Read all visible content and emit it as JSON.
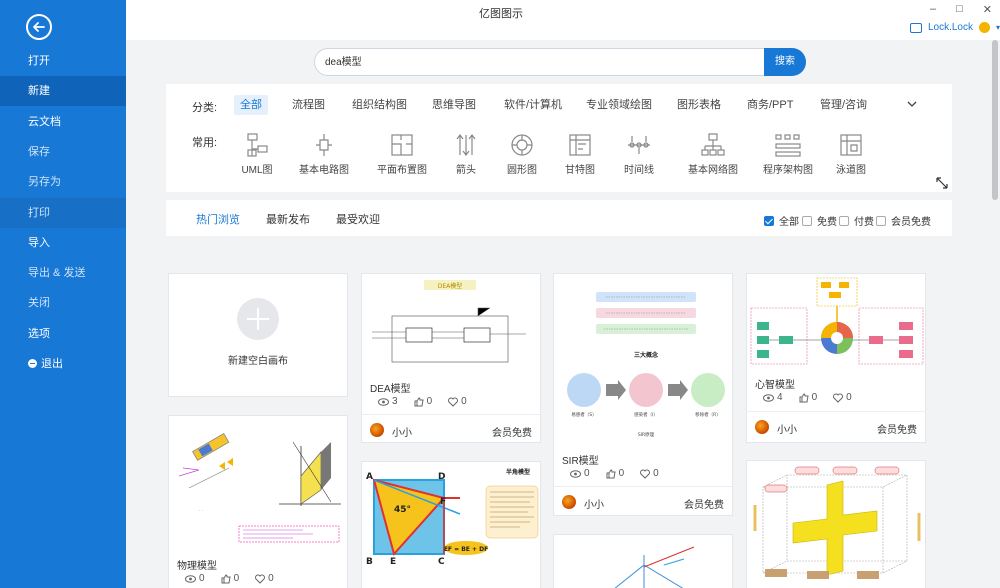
{
  "app": {
    "title": "亿图图示"
  },
  "window": {
    "minimize": "–",
    "maximize": "□",
    "close": "✕"
  },
  "user": {
    "name": "Lock.Lock",
    "caret": "▾"
  },
  "sidebar": {
    "items": [
      {
        "label": "打开",
        "state": "normal"
      },
      {
        "label": "新建",
        "state": "active"
      },
      {
        "label": "云文档",
        "state": "normal"
      },
      {
        "label": "保存",
        "state": "dim"
      },
      {
        "label": "另存为",
        "state": "dim"
      },
      {
        "label": "打印",
        "state": "dim"
      },
      {
        "label": "导入",
        "state": "normal"
      },
      {
        "label": "导出 & 发送",
        "state": "dim"
      },
      {
        "label": "关闭",
        "state": "dim"
      },
      {
        "label": "选项",
        "state": "normal"
      },
      {
        "label": "退出",
        "state": "normal"
      }
    ]
  },
  "search": {
    "value": "dea模型",
    "button": "搜索"
  },
  "categories": {
    "label": "分类:",
    "tabs": [
      "全部",
      "流程图",
      "组织结构图",
      "思维导图",
      "软件/计算机",
      "专业领域绘图",
      "图形表格",
      "商务/PPT",
      "管理/咨询"
    ],
    "active": 0
  },
  "common": {
    "label": "常用:",
    "items": [
      "UML图",
      "基本电路图",
      "平面布置图",
      "箭头",
      "圆形图",
      "甘特图",
      "时间线",
      "基本网络图",
      "程序架构图",
      "泳道图"
    ]
  },
  "filters": {
    "tabs": [
      "热门浏览",
      "最新发布",
      "最受欢迎"
    ],
    "active": 0,
    "checks": [
      {
        "label": "全部",
        "checked": true
      },
      {
        "label": "免费",
        "checked": false
      },
      {
        "label": "付费",
        "checked": false
      },
      {
        "label": "会员免费",
        "checked": false
      }
    ]
  },
  "new_blank": {
    "label": "新建空白画布"
  },
  "cards": [
    {
      "title": "DEA模型",
      "views": "3",
      "likes": "0",
      "favs": "0",
      "author": "小小",
      "price": "会员免费",
      "thumb_label": "DEA模型"
    },
    {
      "title": "SIR模型",
      "views": "0",
      "likes": "0",
      "favs": "0",
      "author": "小小",
      "price": "会员免费",
      "thumb_label": "三大概念",
      "thumb_sub": [
        "易感者（S）",
        "感染者（I）",
        "移除者（R）"
      ],
      "thumb_foot": "SIR原理"
    },
    {
      "title": "心智模型",
      "views": "4",
      "likes": "0",
      "favs": "0",
      "author": "小小",
      "price": "会员免费"
    },
    {
      "title": "物理模型",
      "views": "0",
      "likes": "0",
      "favs": "0"
    },
    {
      "title": "半角模型",
      "thumb_label": "半角模型",
      "angle": "45°",
      "formula": "EF = BE + DF",
      "points": [
        "A",
        "D",
        "F",
        "B",
        "E",
        "C"
      ]
    }
  ],
  "colors": {
    "accent": "#1878d6",
    "sidebar": "#1878d6",
    "sidebar_active": "#0f63b8"
  }
}
